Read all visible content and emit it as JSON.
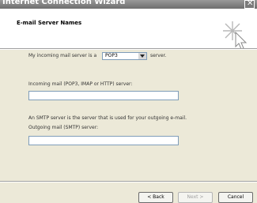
{
  "window": {
    "title": "Internet Connection Wizard",
    "close_symbol": "✕"
  },
  "header": {
    "title": "E-mail Server Names",
    "icon": "wizard-sparkle-cursor-icon"
  },
  "form": {
    "incoming_prefix": "My incoming mail server is a",
    "incoming_type_value": "POP3",
    "incoming_suffix": "server.",
    "incoming_server_label": "Incoming mail (POP3, IMAP or HTTP) server:",
    "incoming_server_value": "",
    "smtp_note": "An SMTP server is the server that is used for your outgoing e-mail.",
    "outgoing_server_label": "Outgoing mail (SMTP) server:",
    "outgoing_server_value": ""
  },
  "buttons": {
    "back": "< Back",
    "next": "Next >",
    "cancel": "Cancel"
  }
}
